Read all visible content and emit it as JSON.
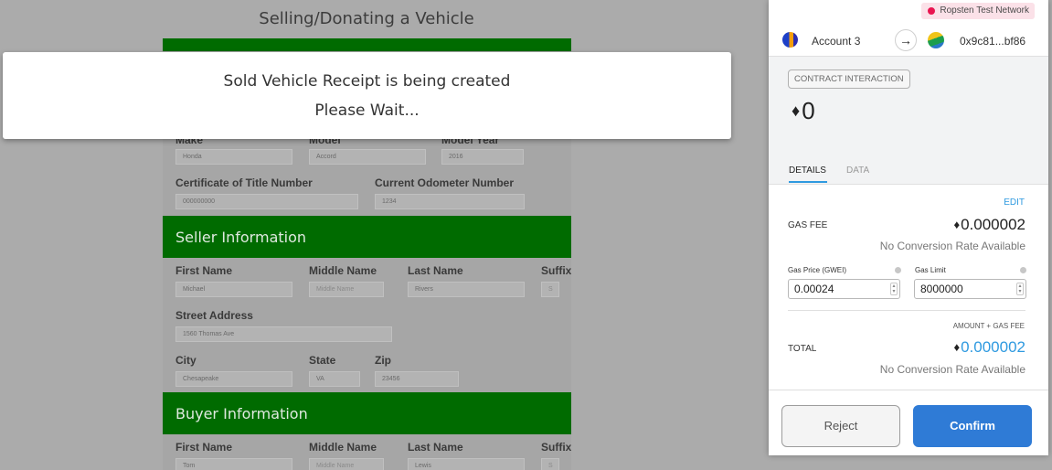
{
  "page": {
    "title": "Selling/Donating a Vehicle"
  },
  "vehicle": {
    "make_label": "Make",
    "make": "Honda",
    "model_label": "Model",
    "model": "Accord",
    "year_label": "Model Year",
    "year": "2016",
    "title_num_label": "Certificate of Title Number",
    "title_num": "000000000",
    "odometer_label": "Current Odometer Number",
    "odometer": "1234"
  },
  "seller": {
    "header": "Seller Information",
    "first_label": "First Name",
    "first": "Michael",
    "middle_label": "Middle Name",
    "middle_ph": "Middle Name",
    "last_label": "Last Name",
    "last": "Rivers",
    "suffix_label": "Suffix",
    "suffix_ph": "S",
    "street_label": "Street Address",
    "street": "1560 Thomas Ave",
    "city_label": "City",
    "city": "Chesapeake",
    "state_label": "State",
    "state": "VA",
    "zip_label": "Zip",
    "zip": "23456"
  },
  "buyer": {
    "header": "Buyer Information",
    "first_label": "First Name",
    "first": "Tom",
    "middle_label": "Middle Name",
    "middle_ph": "Middle Name",
    "last_label": "Last Name",
    "last": "Lewis",
    "suffix_label": "Suffix",
    "suffix_ph": "S"
  },
  "modal": {
    "line1": "Sold Vehicle Receipt is being created",
    "line2": "Please Wait..."
  },
  "metamask": {
    "network": "Ropsten Test Network",
    "account_name": "Account 3",
    "to_address": "0x9c81...bf86",
    "contract_label": "CONTRACT INTERACTION",
    "eth_symbol": "♦",
    "value": "0",
    "tabs": [
      "DETAILS",
      "DATA"
    ],
    "edit_label": "EDIT",
    "gas_fee_label": "GAS FEE",
    "gas_fee": "0.000002",
    "no_conversion": "No Conversion Rate Available",
    "gas_price_label": "Gas Price (GWEI)",
    "gas_price": "0.00024",
    "gas_limit_label": "Gas Limit",
    "gas_limit": "8000000",
    "amount_gas_label": "AMOUNT + GAS FEE",
    "total_label": "TOTAL",
    "total": "0.000002",
    "reject_label": "Reject",
    "confirm_label": "Confirm"
  },
  "colors": {
    "green_bar": "#006b00",
    "network_dot": "#e91550",
    "accent_blue": "#2f7bd6"
  }
}
